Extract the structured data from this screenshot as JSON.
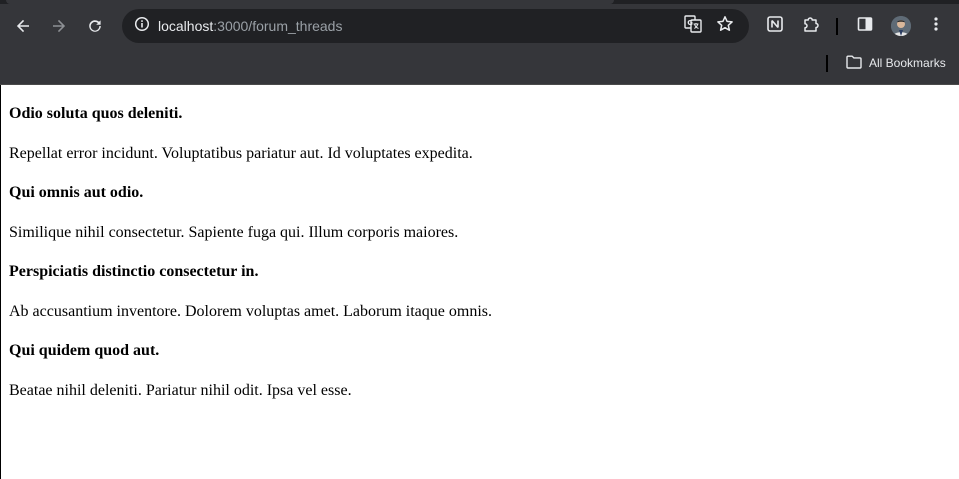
{
  "browser": {
    "address_bar": {
      "host": "localhost",
      "path": ":3000/forum_threads"
    },
    "bookmarks_bar": {
      "all_bookmarks_label": "All Bookmarks"
    },
    "icons": {
      "back": "arrow-left-icon",
      "forward": "arrow-right-icon",
      "reload": "reload-icon",
      "site_info": "site-info-icon",
      "translate": "translate-icon",
      "bookmark_star": "star-icon",
      "notion_extension": "notion-icon",
      "extensions": "puzzle-icon",
      "side_panel": "side-panel-icon",
      "profile": "avatar",
      "menu": "kebab-menu-icon",
      "bookmarks_folder": "folder-icon"
    },
    "colors": {
      "toolbar": "#35363a",
      "omnibox": "#202124",
      "icon": "#e8eaed",
      "url_path": "#9aa0a6"
    }
  },
  "forum_threads": [
    {
      "title": "Odio soluta quos deleniti.",
      "body": "Repellat error incidunt. Voluptatibus pariatur aut. Id voluptates expedita."
    },
    {
      "title": "Qui omnis aut odio.",
      "body": "Similique nihil consectetur. Sapiente fuga qui. Illum corporis maiores."
    },
    {
      "title": "Perspiciatis distinctio consectetur in.",
      "body": "Ab accusantium inventore. Dolorem voluptas amet. Laborum itaque omnis."
    },
    {
      "title": "Qui quidem quod aut.",
      "body": "Beatae nihil deleniti. Pariatur nihil odit. Ipsa vel esse."
    }
  ]
}
